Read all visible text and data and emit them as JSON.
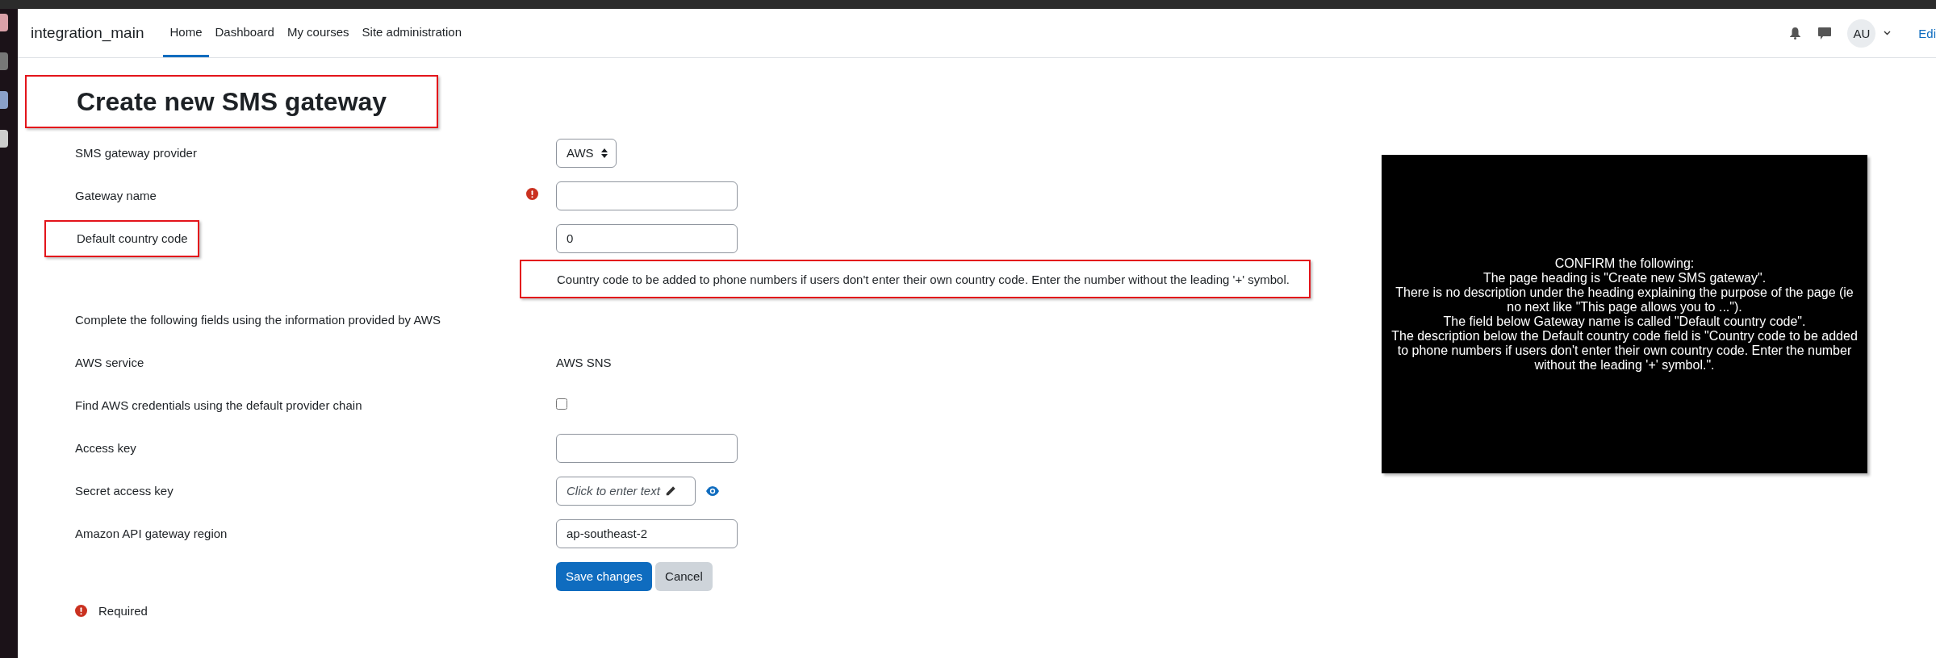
{
  "top_nav": {
    "site_name": "integration_main",
    "links": [
      {
        "label": "Home",
        "selected": true
      },
      {
        "label": "Dashboard",
        "selected": false
      },
      {
        "label": "My courses",
        "selected": false
      },
      {
        "label": "Site administration",
        "selected": false
      }
    ],
    "avatar": "AU",
    "edit_label": "Edi"
  },
  "heading": {
    "text": "Create new SMS gateway",
    "highlighted": true
  },
  "fields": [
    {
      "kind": "select",
      "label": "SMS gateway provider",
      "value": "AWS"
    },
    {
      "kind": "text",
      "label": "Gateway name",
      "required": true
    },
    {
      "kind": "text",
      "label": "Default country code",
      "value": "0",
      "highlighted": true,
      "help": {
        "text": "Country code to be added to phone numbers if users don't enter their own country code. Enter the number without the leading '+' symbol.",
        "highlighted": true
      }
    },
    {
      "kind": "note",
      "label": "Complete the following fields using the information provided by AWS"
    },
    {
      "kind": "static",
      "label": "AWS service",
      "value": "AWS SNS"
    },
    {
      "kind": "checkbox",
      "label": "Find AWS credentials using the default provider chain",
      "checked": false
    },
    {
      "kind": "text",
      "label": "Access key"
    },
    {
      "kind": "secret",
      "label": "Secret access key",
      "placeholder": "Click to enter text"
    },
    {
      "kind": "text",
      "label": "Amazon API gateway region",
      "value": "ap-southeast-2"
    }
  ],
  "buttons": [
    {
      "label": "Save changes",
      "primary": true
    },
    {
      "label": "Cancel",
      "primary": false
    }
  ],
  "required_legend": "Required",
  "notice": {
    "lines": [
      "CONFIRM the following:",
      "The page heading is \"Create new SMS gateway\".",
      "There is no description under the heading explaining the purpose of the page (ie no next like \"This page allows you to ...\").",
      "The field below Gateway name is called \"Default country code\".",
      "The description below the Default country code field is \"Country code to be added to phone numbers if users don't enter their own country code. Enter the number without the leading '+' symbol.\"."
    ]
  }
}
